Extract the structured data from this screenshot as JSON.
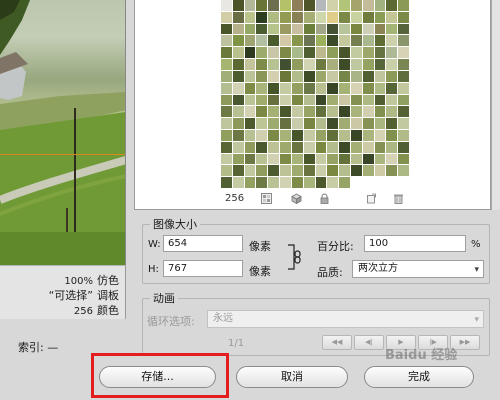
{
  "preview": {
    "info": [
      {
        "value": "100%",
        "label": "仿色"
      },
      {
        "value": "“可选择”",
        "label": "调板"
      },
      {
        "value": "256",
        "label": "颜色"
      }
    ]
  },
  "index": {
    "label": "索引: —"
  },
  "swatches": {
    "count": "256",
    "colors": [
      "#e9e7e3",
      "#4c5326",
      "#b2b79a",
      "#6b7437",
      "#6d6e4d",
      "#b5c168",
      "#8e7f58",
      "#505529",
      "#b4b8bb",
      "#d1d1aa",
      "#b1c478",
      "#a3a56d",
      "#c3bb9a",
      "#a2b27e",
      "#5c6932",
      "#8b9a55",
      "#d0cda7",
      "#6a6d43",
      "#bac38b",
      "#2c3e1f",
      "#aebc84",
      "#939a51",
      "#878155",
      "#a7ae74",
      "#cfd6a9",
      "#dfcd89",
      "#7a8945",
      "#c8d1a0",
      "#6f7c3e",
      "#8a9d56",
      "#c4c695",
      "#7b8b47",
      "#495627",
      "#b5b18a",
      "#95a865",
      "#4a5d31",
      "#b4c48a",
      "#9b9a60",
      "#c9bfa0",
      "#6b7f3b",
      "#a2a78a",
      "#425233",
      "#b8c59b",
      "#7a8741",
      "#cdd0b6",
      "#8c8454",
      "#a3b574",
      "#55643a",
      "#bfc29f",
      "#7f9344",
      "#9fa572",
      "#b2bfa0",
      "#495a2b",
      "#d3c9a6",
      "#88964c",
      "#6b7552",
      "#9db15d",
      "#3b4a28",
      "#c5c89d",
      "#747e4f",
      "#aab98d",
      "#5e6d34",
      "#cdd1ab",
      "#8a9569",
      "#6b7a3b",
      "#b8c08c",
      "#2e3a1f",
      "#9caa6b",
      "#c9c5a7",
      "#7c8a45",
      "#a8b98a",
      "#505f2f",
      "#bbb98d",
      "#8d9e5a",
      "#48552b",
      "#c2cba0",
      "#9da76a",
      "#657341",
      "#adb894",
      "#d6d2b6",
      "#a6b56f",
      "#5b6933",
      "#c6c49a",
      "#7e8c4a",
      "#b7c292",
      "#415030",
      "#8f9c5e",
      "#d0d4b3",
      "#6c7a40",
      "#a9b07e",
      "#3d4b26",
      "#bfc9a0",
      "#94a362",
      "#576638",
      "#c9cfa8",
      "#7b8752",
      "#a2ae78",
      "#4e5d30",
      "#bbc496",
      "#8a9558",
      "#d4cfae",
      "#6a7739",
      "#b0bd8a",
      "#3f4d27",
      "#9ca86a",
      "#c7c9a5",
      "#768548",
      "#aab587",
      "#525f32",
      "#c1c59e",
      "#8b9b57",
      "#5f6c3b",
      "#b3bf91",
      "#d1d3b4",
      "#7d8b46",
      "#a7b57a",
      "#465429",
      "#c4cba2",
      "#93a061",
      "#6a7747",
      "#b9bf8f",
      "#384626",
      "#a5b276",
      "#d7d2b4",
      "#7f8e4c",
      "#afbb87",
      "#566535",
      "#c3c79e",
      "#8d9a5c",
      "#4a5830",
      "#bbc494",
      "#9fac6c",
      "#666f3d",
      "#cbcfaa",
      "#7a8843",
      "#b4bd90",
      "#3b4828",
      "#a1ad71",
      "#cbc7a4",
      "#848f52",
      "#adb982",
      "#515e31",
      "#c0c79c",
      "#90a060",
      "#6e7a45",
      "#b6c092",
      "#d3d2b2",
      "#7b8944",
      "#a3b175",
      "#49572a",
      "#c5c9a1",
      "#96a466",
      "#62703b",
      "#b8bf8e",
      "#3a4727",
      "#a8b47b",
      "#d2cfb1",
      "#82914f",
      "#aeb986",
      "#556334",
      "#bfc59c",
      "#8c995b",
      "#4c5a2e",
      "#bec595",
      "#9dab6e",
      "#67713f",
      "#c8ccaa",
      "#788641",
      "#b3bc8e",
      "#3e4c29",
      "#a0ac72",
      "#ccc8a5",
      "#879355",
      "#aab680",
      "#536031",
      "#c2c89f",
      "#919f5e",
      "#6b7843",
      "#b7c193",
      "#d0cfb0",
      "#7c8a48",
      "#a5b377",
      "#47552a",
      "#c6caa2",
      "#94a264",
      "#617039",
      "#b6be8d",
      "#394626",
      "#a9b57c",
      "#d5d1b3",
      "#80904d",
      "#b0bb88",
      "#586634",
      "#c0c69d",
      "#8e9b5d",
      "#4b592f",
      "#bcc294",
      "#9eaa6d",
      "#68733e",
      "#cacdaa",
      "#79873f",
      "#b2bc8d",
      "#3c4a28",
      "#a3af74",
      "#cdcaa6",
      "#859154",
      "#acb883",
      "#516032",
      "#c3c9a0",
      "#92a05f",
      "#6c7944",
      "#b8c194",
      "#d1d0b1",
      "#7e8b47",
      "#a6b479",
      "#4a582c",
      "#c7cba3",
      "#95a365",
      "#63713a",
      "#b5bd8c",
      "#384527",
      "#aab67d",
      "#d6d2b5",
      "#82914e",
      "#b1bc89",
      "#576535",
      "#c1c79e",
      "#8f9c5e",
      "#4d5b30",
      "#bdc396",
      "#9fab6e",
      "#69743f",
      "#cbceab",
      "#7a8840",
      "#b3bd8e",
      "#3d4b29",
      "#a2ae73",
      "#cecba7",
      "#869255",
      "#adb984",
      "#526132",
      "#c4caa1",
      "#93a160",
      "#6d7a45",
      "#b9c295",
      "#d2d1b2",
      "#7f8c48",
      "#a7b57a",
      "#4b592d",
      "#c8cca4",
      "#96a466"
    ]
  },
  "image_size": {
    "title": "图像大小",
    "w_label": "W:",
    "w_value": "654",
    "h_label": "H:",
    "h_value": "767",
    "unit": "像素",
    "percent_label": "百分比:",
    "percent_value": "100",
    "percent_unit": "%",
    "quality_label": "品质:",
    "quality_value": "两次立方"
  },
  "animation": {
    "title": "动画",
    "loop_label": "循环选项:",
    "loop_value": "永远",
    "frame_counter": "1/1"
  },
  "buttons": {
    "save": "存储...",
    "cancel": "取消",
    "done": "完成"
  },
  "watermark": "Baidu 经验",
  "colors": {
    "highlight": "#e41e1e",
    "panel_bg": "#d8d8d8"
  }
}
